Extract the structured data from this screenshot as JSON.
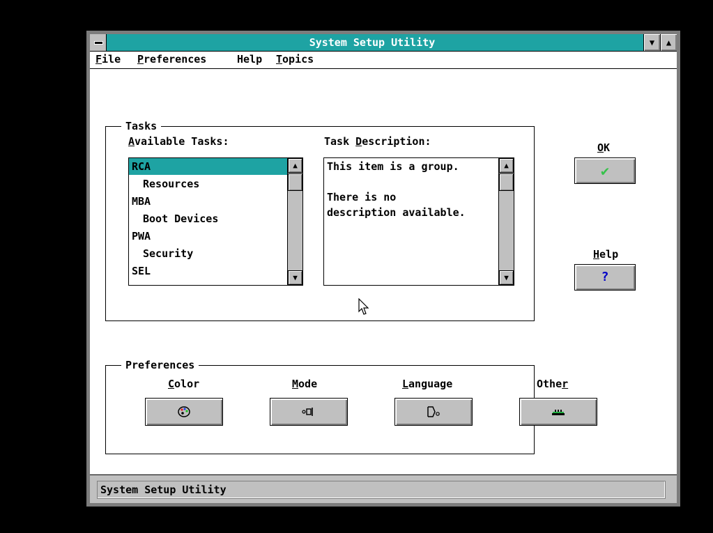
{
  "window": {
    "title": "System Setup Utility",
    "controls": [
      "▼",
      "▲"
    ]
  },
  "menubar": {
    "items": [
      {
        "label": "File",
        "accel": "F",
        "rest": "ile"
      },
      {
        "label": "Preferences",
        "accel": "P",
        "rest": "references"
      },
      {
        "label": "Help",
        "accel": "",
        "rest": "Help"
      },
      {
        "label": "Topics",
        "accel": "T",
        "rest": "opics"
      }
    ]
  },
  "tasks": {
    "group_title": "Tasks",
    "available_label_accel": "A",
    "available_label_rest": "vailable Tasks:",
    "items": [
      {
        "label": "RCA",
        "indent": false,
        "selected": true
      },
      {
        "label": "Resources",
        "indent": true,
        "selected": false
      },
      {
        "label": "MBA",
        "indent": false,
        "selected": false
      },
      {
        "label": "Boot Devices",
        "indent": true,
        "selected": false
      },
      {
        "label": "PWA",
        "indent": false,
        "selected": false
      },
      {
        "label": "Security",
        "indent": true,
        "selected": false
      },
      {
        "label": "SEL",
        "indent": false,
        "selected": false
      }
    ],
    "description_label_pre": "Task ",
    "description_label_accel": "D",
    "description_label_rest": "escription:",
    "description_text": "This item is a group.\n\nThere is no\ndescription available."
  },
  "buttons": {
    "ok_accel": "O",
    "ok_rest": "K",
    "ok_glyph": "✔",
    "help_accel": "H",
    "help_rest": "elp",
    "help_glyph": "?"
  },
  "preferences": {
    "group_title": "Preferences",
    "items": [
      {
        "label_pre": "",
        "accel": "C",
        "label_rest": "olor",
        "icon": "palette-icon"
      },
      {
        "label_pre": "",
        "accel": "M",
        "label_rest": "ode",
        "icon": "mode-icon"
      },
      {
        "label_pre": "",
        "accel": "L",
        "label_rest": "anguage",
        "icon": "language-icon"
      },
      {
        "label_pre": "Othe",
        "accel": "r",
        "label_rest": "",
        "icon": "other-icon"
      }
    ]
  },
  "status": {
    "text": "System Setup Utility"
  },
  "colors": {
    "title_bar": "#1ea3a3",
    "selection": "#1ea3a3",
    "check": "#36c24a",
    "help_glyph": "#0000c8"
  }
}
